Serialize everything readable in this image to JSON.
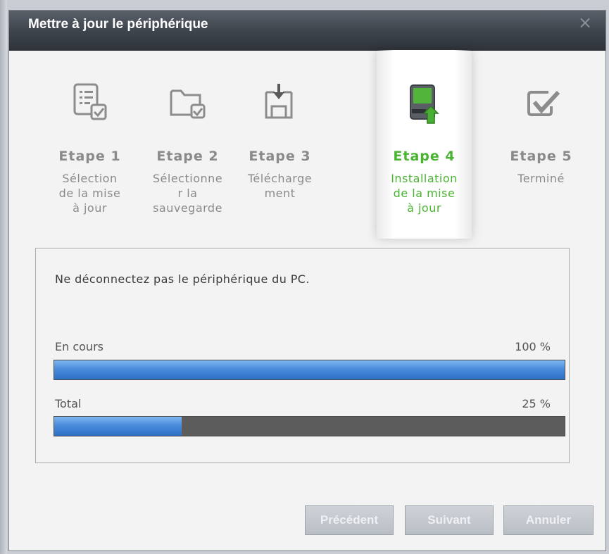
{
  "window": {
    "title": "Mettre à jour le périphérique",
    "close_glyph": "×"
  },
  "steps": [
    {
      "label": "Etape 1",
      "desc": "Sélection\nde la mise\nà jour",
      "icon": "checklist-icon",
      "state": "done"
    },
    {
      "label": "Etape 2",
      "desc": "Sélectionne\nr la\nsauvegarde",
      "icon": "folder-check-icon",
      "state": "done"
    },
    {
      "label": "Etape 3",
      "desc": "Télécharge\nment",
      "icon": "download-icon",
      "state": "done"
    },
    {
      "label": "Etape 4",
      "desc": "Installation\nde la mise\nà jour",
      "icon": "device-install-icon",
      "state": "active"
    },
    {
      "label": "Etape 5",
      "desc": "Terminé",
      "icon": "checkmark-icon",
      "state": "pending"
    }
  ],
  "panel": {
    "message": "Ne déconnectez pas le périphérique du PC.",
    "current": {
      "label": "En cours",
      "value_text": "100 %",
      "fraction": 1.0
    },
    "total": {
      "label": "Total",
      "value_text": "25 %",
      "fraction": 0.25
    }
  },
  "buttons": {
    "previous": "Précédent",
    "next": "Suivant",
    "cancel": "Annuler"
  },
  "colors": {
    "active_step": "#49b431",
    "inactive_step": "#8a8a8a",
    "progress_fill": "#3d80d2",
    "progress_track": "#5c5c5c",
    "titlebar": "#3d434b"
  }
}
